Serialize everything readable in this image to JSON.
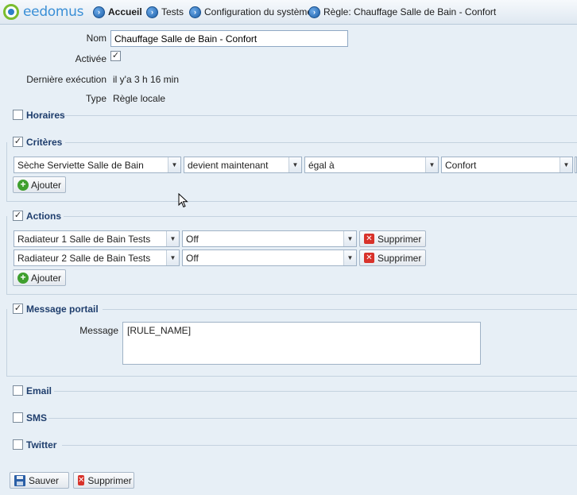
{
  "header": {
    "logo_text": "eedomus",
    "breadcrumbs": [
      {
        "label": "Accueil"
      },
      {
        "label": "Tests"
      },
      {
        "label": "Configuration du système"
      },
      {
        "label": "Règle: Chauffage Salle de Bain - Confort"
      }
    ]
  },
  "rule": {
    "nom_label": "Nom",
    "nom_value": "Chauffage Salle de Bain - Confort",
    "activee_label": "Activée",
    "activee_checked": "✓",
    "derniere_label": "Dernière exécution",
    "derniere_value": "il y'a 3 h 16 min",
    "type_label": "Type",
    "type_value": "Règle locale"
  },
  "sections": {
    "horaires": {
      "title": "Horaires",
      "checked": ""
    },
    "criteres": {
      "title": "Critères",
      "checked": "✓"
    },
    "actions": {
      "title": "Actions",
      "checked": "✓"
    },
    "message_portail": {
      "title": "Message portail",
      "checked": "✓"
    },
    "email": {
      "title": "Email",
      "checked": ""
    },
    "sms": {
      "title": "SMS",
      "checked": ""
    },
    "twitter": {
      "title": "Twitter",
      "checked": ""
    }
  },
  "criteres": {
    "device": "Sèche Serviette Salle de Bain",
    "condition": "devient maintenant",
    "operator": "égal à",
    "value": "Confort",
    "add_label": "Ajouter"
  },
  "actions": {
    "rows": [
      {
        "device": "Radiateur 1 Salle de Bain Tests",
        "value": "Off",
        "delete_label": "Supprimer"
      },
      {
        "device": "Radiateur 2 Salle de Bain Tests",
        "value": "Off",
        "delete_label": "Supprimer"
      }
    ],
    "add_label": "Ajouter"
  },
  "message": {
    "label": "Message",
    "value": "[RULE_NAME]"
  },
  "footer": {
    "save_label": "Sauver",
    "delete_label": "Supprimer"
  },
  "icons": {
    "nav": "circle-arrow-right-icon",
    "add": "plus-circle-icon",
    "delete": "red-x-icon",
    "save": "floppy-disk-icon"
  },
  "colors": {
    "background": "#e7eff6",
    "section_title": "#1f3e6d",
    "logo": "#3a8fd6"
  }
}
